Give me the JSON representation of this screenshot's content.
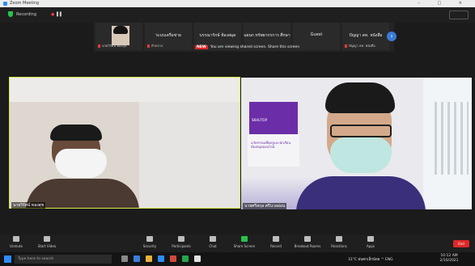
{
  "window": {
    "title": "Zoom Meeting",
    "controls": "–  □  ×"
  },
  "top": {
    "recording_label": "Recording",
    "view_label": "View"
  },
  "gallery": {
    "thumbs": [
      {
        "name": "",
        "subtitle": "นายวิรัตน์ ทองสุข"
      },
      {
        "name": "ระบบเครือข่าย",
        "subtitle": "ตัวกลาง"
      },
      {
        "name": "บรรณารักษ์ ห้องสมุด",
        "subtitle": ""
      },
      {
        "name": "แผนก ทรัพยากรการ ศึกษา",
        "subtitle": ""
      },
      {
        "name": "Guest",
        "subtitle": ""
      },
      {
        "name": "ปัญญา ลท. หนังสือ",
        "subtitle": "ปัญญา ลท. หนังสือ"
      }
    ],
    "share_badge": "NEW",
    "share_text": "You are viewing shared screen. Share this screen"
  },
  "videos": {
    "left_name": "นายวิรัตน์ ทองสุข",
    "right_name": "นายศรีสกุล ศรีนวลอ่อน",
    "poster_brand": "SKHUTOP",
    "poster_text": "นวัตกรรมเพื่อครูและนักเรียน ห้องสมุดออนไลน์"
  },
  "toolbar": {
    "buttons": [
      {
        "label": "Unmute",
        "green": false
      },
      {
        "label": "Start Video",
        "green": false
      },
      {
        "label": "Security",
        "green": false
      },
      {
        "label": "Participants",
        "green": false
      },
      {
        "label": "Chat",
        "green": false
      },
      {
        "label": "Share Screen",
        "green": true
      },
      {
        "label": "Record",
        "green": false
      },
      {
        "label": "Breakout Rooms",
        "green": false
      },
      {
        "label": "Reactions",
        "green": false
      },
      {
        "label": "Apps",
        "green": false
      }
    ],
    "end_label": "End"
  },
  "taskbar": {
    "search_placeholder": "Type here to search",
    "tray_text": "31°C  ฝนตกเล็กน้อย  ^  ENG",
    "clock_time": "10:12 AM",
    "clock_date": "2/10/2021"
  },
  "colors": {
    "accent": "#2d8cff",
    "share_green": "#27c24c",
    "end_red": "#e02828",
    "speaker_border": "#d8e64a"
  }
}
